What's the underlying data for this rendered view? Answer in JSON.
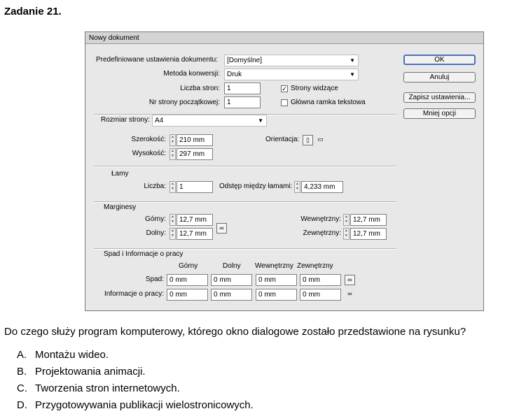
{
  "heading": "Zadanie 21.",
  "dialog": {
    "title": "Nowy dokument",
    "preset_label": "Predefiniowane ustawienia dokumentu:",
    "preset_value": "[Domyślne]",
    "method_label": "Metoda konwersji:",
    "method_value": "Druk",
    "pages_label": "Liczba stron:",
    "pages_value": "1",
    "start_label": "Nr strony początkowej:",
    "start_value": "1",
    "facing_label": "Strony widzące",
    "facing_checked": true,
    "master_label": "Główna ramka tekstowa",
    "master_checked": false,
    "buttons": {
      "ok": "OK",
      "cancel": "Anuluj",
      "save": "Zapisz ustawienia...",
      "fewer": "Mniej opcji"
    },
    "page_size_label": "Rozmiar strony:",
    "page_size_value": "A4",
    "width_label": "Szerokość:",
    "width_value": "210 mm",
    "height_label": "Wysokość:",
    "height_value": "297 mm",
    "orientation_label": "Orientacja:",
    "columns": {
      "title": "Łamy",
      "count_label": "Liczba:",
      "count_value": "1",
      "gutter_label": "Odstęp między łamami:",
      "gutter_value": "4,233 mm"
    },
    "margins": {
      "title": "Marginesy",
      "top_label": "Górny:",
      "top_value": "12,7 mm",
      "bottom_label": "Dolny:",
      "bottom_value": "12,7 mm",
      "inside_label": "Wewnętrzny:",
      "inside_value": "12,7 mm",
      "outside_label": "Zewnętrzny:",
      "outside_value": "12,7 mm"
    },
    "bleed": {
      "title": "Spad i Informacje o pracy",
      "col_top": "Górny",
      "col_bottom": "Dolny",
      "col_inside": "Wewnętrzny",
      "col_outside": "Zewnętrzny",
      "bleed_label": "Spad:",
      "slug_label": "Informacje o pracy:",
      "bleed_values": [
        "0 mm",
        "0 mm",
        "0 mm",
        "0 mm"
      ],
      "slug_values": [
        "0 mm",
        "0 mm",
        "0 mm",
        "0 mm"
      ]
    }
  },
  "question": "Do czego służy program komputerowy, którego okno dialogowe zostało przedstawione na rysunku?",
  "answers": [
    {
      "letter": "A.",
      "text": "Montażu wideo."
    },
    {
      "letter": "B.",
      "text": "Projektowania animacji."
    },
    {
      "letter": "C.",
      "text": "Tworzenia stron internetowych."
    },
    {
      "letter": "D.",
      "text": "Przygotowywania publikacji wielostronicowych."
    }
  ]
}
